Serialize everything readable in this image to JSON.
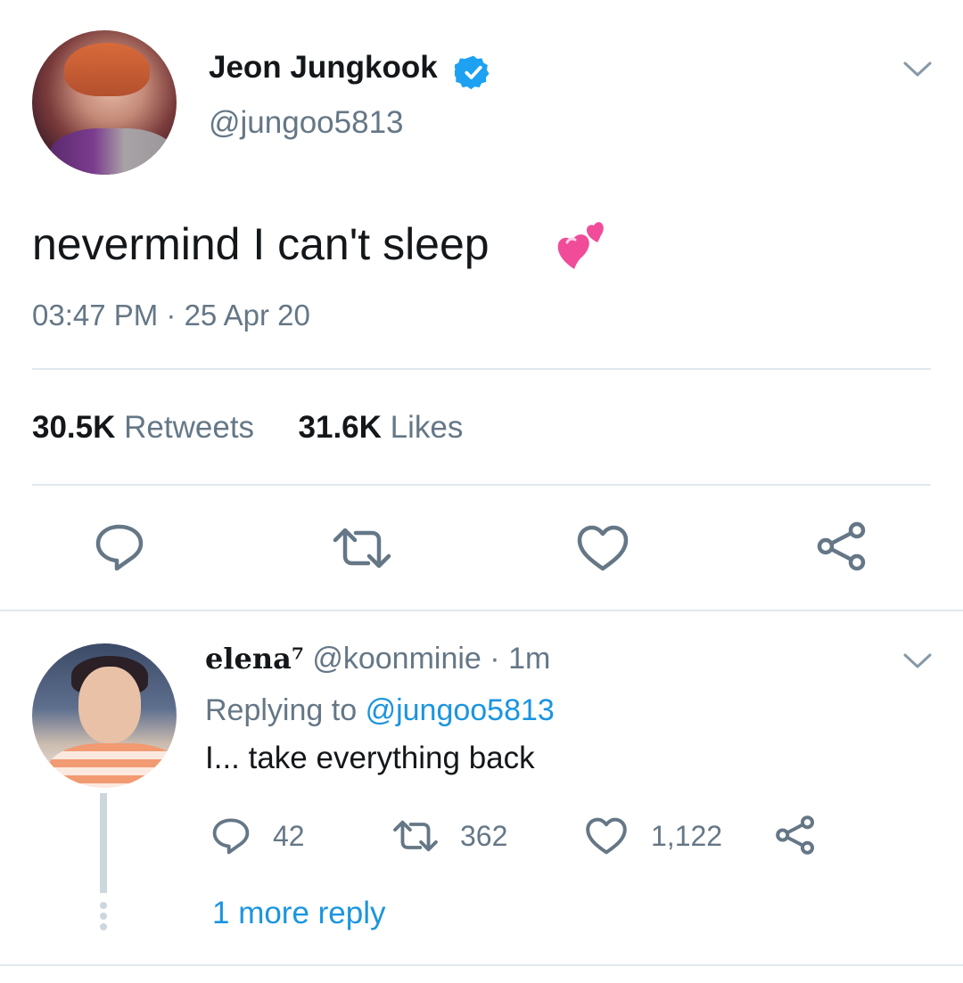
{
  "tweet": {
    "display_name": "Jeon Jungkook",
    "handle": "@jungoo5813",
    "text": "nevermind I can't sleep",
    "emoji": "two-hearts-emoji",
    "timestamp": "03:47 PM · 25 Apr 20",
    "retweets_count": "30.5K",
    "retweets_label": "Retweets",
    "likes_count": "31.6K",
    "likes_label": "Likes"
  },
  "reply": {
    "display_name": "elena⁷",
    "handle": "@koonminie",
    "time": "· 1m",
    "replying_prefix": "Replying to",
    "replying_to": "@jungoo5813",
    "text": "I... take everything back",
    "reply_count": "42",
    "retweet_count": "362",
    "like_count": "1,122",
    "more_replies": "1 more reply"
  },
  "colors": {
    "accent": "#1da1f2",
    "link": "#1b95e0",
    "secondary_text": "#657786",
    "icon": "#657786",
    "divider": "#e1e8ed"
  }
}
